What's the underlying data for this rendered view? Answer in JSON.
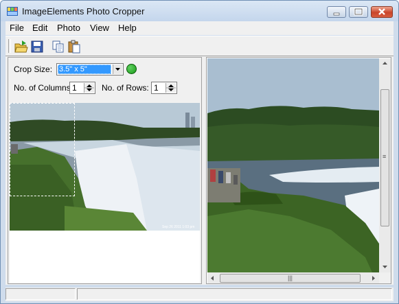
{
  "window": {
    "title": "ImageElements Photo Cropper"
  },
  "menu": {
    "items": [
      "File",
      "Edit",
      "Photo",
      "View",
      "Help"
    ]
  },
  "toolbar": {
    "icons": [
      "open-icon",
      "save-icon",
      "copy-icon",
      "paste-icon"
    ]
  },
  "crop_panel": {
    "crop_size_label": "Crop Size:",
    "crop_size_value": "3.5\" x 5\"",
    "columns_label": "No. of Columns:",
    "columns_value": "1",
    "rows_label": "No. of Rows:",
    "rows_value": "1",
    "status_color": "#1a9a1a"
  },
  "thumbnail": {
    "watermark": "Sep 26 2011 1:03 pm"
  },
  "colors": {
    "titlebar": "#c4d6ec",
    "selection": "#3399ff",
    "sky": "#a9bed0",
    "grass": "#4c7a30"
  },
  "statusbar": {
    "text1": "",
    "text2": ""
  }
}
